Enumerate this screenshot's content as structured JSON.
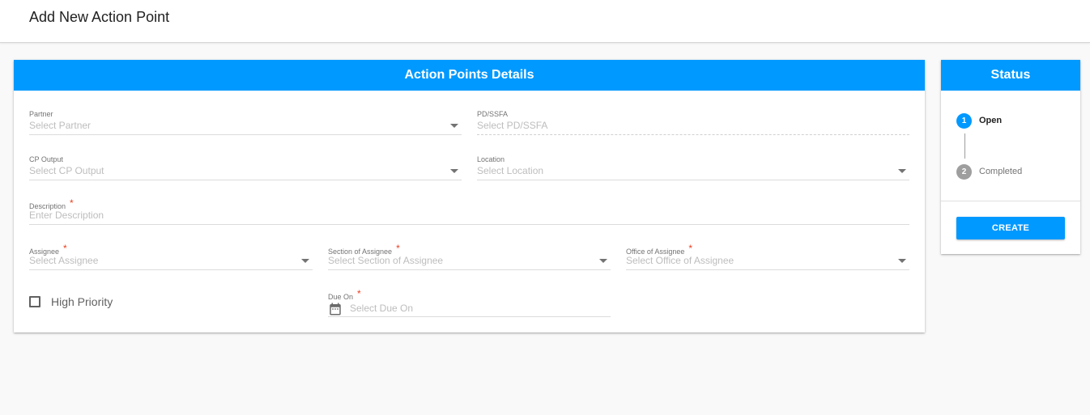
{
  "page": {
    "title": "Add New Action Point"
  },
  "details": {
    "heading": "Action Points Details",
    "partner": {
      "label": "Partner",
      "placeholder": "Select Partner"
    },
    "pd_ssfa": {
      "label": "PD/SSFA",
      "placeholder": "Select PD/SSFA"
    },
    "cp_output": {
      "label": "CP Output",
      "placeholder": "Select CP Output"
    },
    "location": {
      "label": "Location",
      "placeholder": "Select Location"
    },
    "description": {
      "label": "Description",
      "placeholder": "Enter Description",
      "required_mark": "*"
    },
    "assignee": {
      "label": "Assignee",
      "placeholder": "Select Assignee",
      "required_mark": "*"
    },
    "section": {
      "label": "Section of Assignee",
      "placeholder": "Select Section of Assignee",
      "required_mark": "*"
    },
    "office": {
      "label": "Office of Assignee",
      "placeholder": "Select Office of Assignee",
      "required_mark": "*"
    },
    "high_priority": {
      "label": "High Priority",
      "checked": false
    },
    "due_on": {
      "label": "Due On",
      "placeholder": "Select Due On",
      "required_mark": "*",
      "icon": "calendar-icon"
    }
  },
  "status": {
    "heading": "Status",
    "steps": [
      {
        "number": "1",
        "label": "Open",
        "active": true
      },
      {
        "number": "2",
        "label": "Completed",
        "active": false
      }
    ],
    "create_label": "CREATE"
  },
  "colors": {
    "accent": "#0099ff",
    "required": "#ea4022",
    "step_active": "#0099ff",
    "step_inactive": "#9e9e9e"
  }
}
